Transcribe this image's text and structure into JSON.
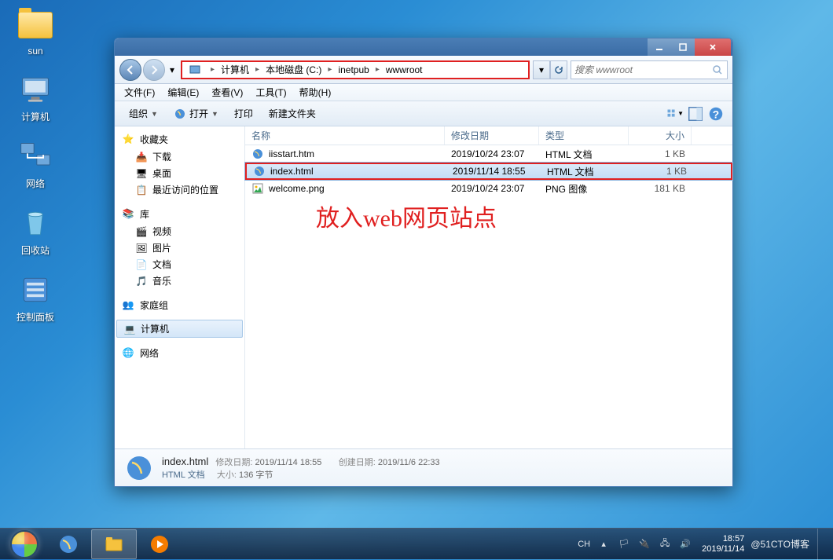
{
  "desktop": {
    "icons": [
      {
        "name": "sun"
      },
      {
        "name": "计算机"
      },
      {
        "name": "网络"
      },
      {
        "name": "回收站"
      },
      {
        "name": "控制面板"
      }
    ]
  },
  "window": {
    "breadcrumb": {
      "root_icon": "computer",
      "parts": [
        "计算机",
        "本地磁盘 (C:)",
        "inetpub",
        "wwwroot"
      ]
    },
    "search_placeholder": "搜索 wwwroot",
    "menus": [
      "文件(F)",
      "编辑(E)",
      "查看(V)",
      "工具(T)",
      "帮助(H)"
    ],
    "toolbar": {
      "organize": "组织",
      "open": "打开",
      "print": "打印",
      "newfolder": "新建文件夹"
    },
    "columns": {
      "name": "名称",
      "date": "修改日期",
      "type": "类型",
      "size": "大小"
    },
    "files": [
      {
        "name": "iisstart.htm",
        "date": "2019/10/24 23:07",
        "type": "HTML 文档",
        "size": "1 KB",
        "icon": "ie"
      },
      {
        "name": "index.html",
        "date": "2019/11/14 18:55",
        "type": "HTML 文档",
        "size": "1 KB",
        "icon": "ie",
        "selected": true,
        "redbox": true
      },
      {
        "name": "welcome.png",
        "date": "2019/10/24 23:07",
        "type": "PNG 图像",
        "size": "181 KB",
        "icon": "png"
      }
    ],
    "overlay": "放入web网页站点",
    "sidebar": {
      "favorites": {
        "label": "收藏夹",
        "items": [
          "下载",
          "桌面",
          "最近访问的位置"
        ]
      },
      "libraries": {
        "label": "库",
        "items": [
          "视频",
          "图片",
          "文档",
          "音乐"
        ]
      },
      "homegroup": {
        "label": "家庭组"
      },
      "computer": {
        "label": "计算机"
      },
      "network": {
        "label": "网络"
      }
    },
    "details": {
      "name": "index.html",
      "subtype": "HTML 文档",
      "mod_label": "修改日期:",
      "mod": "2019/11/14 18:55",
      "size_label": "大小:",
      "size": "136 字节",
      "created_label": "创建日期:",
      "created": "2019/11/6 22:33"
    }
  },
  "taskbar": {
    "lang": "CH",
    "watermark": "@51CTO博客",
    "time": "18:57",
    "date": "2019/11/14"
  }
}
